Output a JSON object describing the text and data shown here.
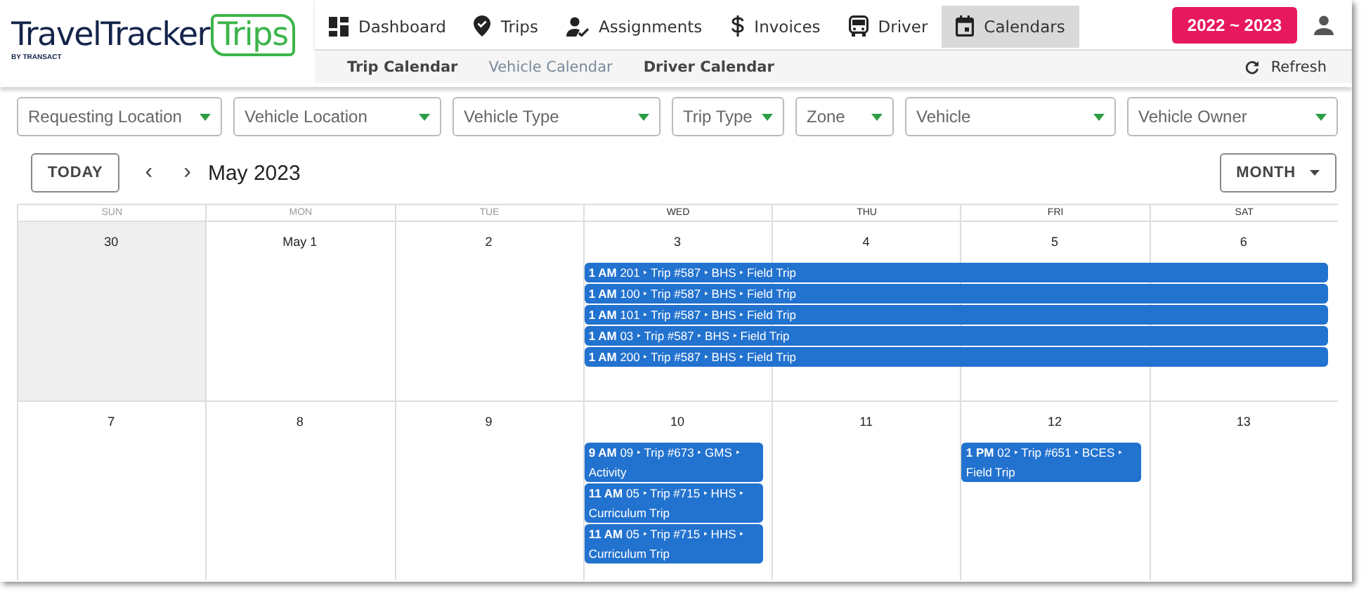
{
  "logo": {
    "brand": "TravelTracker",
    "product": "Trips",
    "byline": "BY TRANSACT"
  },
  "nav": [
    {
      "label": "Dashboard",
      "selected": false
    },
    {
      "label": "Trips",
      "selected": false
    },
    {
      "label": "Assignments",
      "selected": false
    },
    {
      "label": "Invoices",
      "selected": false
    },
    {
      "label": "Driver",
      "selected": false
    },
    {
      "label": "Calendars",
      "selected": true
    }
  ],
  "year_button": "2022 ~ 2023",
  "subnav": [
    {
      "label": "Trip Calendar",
      "selected": false
    },
    {
      "label": "Vehicle Calendar",
      "selected": true
    },
    {
      "label": "Driver Calendar",
      "selected": false
    }
  ],
  "refresh_button": "Refresh",
  "filters": [
    {
      "placeholder": "Requesting Location"
    },
    {
      "placeholder": "Vehicle Location"
    },
    {
      "placeholder": "Vehicle Type"
    },
    {
      "placeholder": "Trip Type"
    },
    {
      "placeholder": "Zone"
    },
    {
      "placeholder": "Vehicle"
    },
    {
      "placeholder": "Vehicle Owner"
    }
  ],
  "toolbar": {
    "today_button": "TODAY",
    "prev": "‹",
    "next": "›",
    "month_title": "May 2023",
    "view_button": "MONTH"
  },
  "weekdays": [
    "SUN",
    "MON",
    "TUE",
    "WED",
    "THU",
    "FRI",
    "SAT"
  ],
  "weeks": [
    {
      "days": [
        {
          "date": "30",
          "other_month": true
        },
        {
          "date": "May 1",
          "other_month": false
        },
        {
          "date": "2",
          "other_month": false
        },
        {
          "date": "3",
          "other_month": false,
          "events": [
            {
              "kind": "week-span",
              "text": "**1 AM** 201 ‣ Trip #587 ‣ BHS ‣ Field Trip"
            },
            {
              "kind": "week-span",
              "text": "**1 AM** 100 ‣ Trip #587 ‣ BHS ‣ Field Trip"
            },
            {
              "kind": "week-span",
              "text": "**1 AM** 101 ‣ Trip #587 ‣ BHS ‣ Field Trip"
            },
            {
              "kind": "week-span",
              "text": "**1 AM** 03 ‣ Trip #587 ‣ BHS ‣ Field Trip"
            },
            {
              "kind": "week-span",
              "text": "**1 AM** 200 ‣ Trip #587 ‣ BHS ‣ Field Trip"
            }
          ]
        },
        {
          "date": "4",
          "other_month": false
        },
        {
          "date": "5",
          "other_month": false
        },
        {
          "date": "6",
          "other_month": false
        }
      ]
    },
    {
      "days": [
        {
          "date": "7",
          "other_month": false
        },
        {
          "date": "8",
          "other_month": false
        },
        {
          "date": "9",
          "other_month": false
        },
        {
          "date": "10",
          "other_month": false,
          "events": [
            {
              "kind": "single-day",
              "text": "**9 AM** 09 ‣ Trip #673 ‣ GMS ‣ Activity"
            },
            {
              "kind": "single-day",
              "text": "**11 AM** 05 ‣ Trip #715 ‣ HHS ‣ Curriculum Trip"
            },
            {
              "kind": "single-day",
              "text": "**11 AM** 05 ‣ Trip #715 ‣ HHS ‣ Curriculum Trip"
            }
          ]
        },
        {
          "date": "11",
          "other_month": false
        },
        {
          "date": "12",
          "other_month": false,
          "events": [
            {
              "kind": "single-day",
              "text": "**1 PM** 02 ‣ Trip #651 ‣ BCES ‣ Field Trip"
            }
          ]
        },
        {
          "date": "13",
          "other_month": false
        }
      ]
    }
  ]
}
